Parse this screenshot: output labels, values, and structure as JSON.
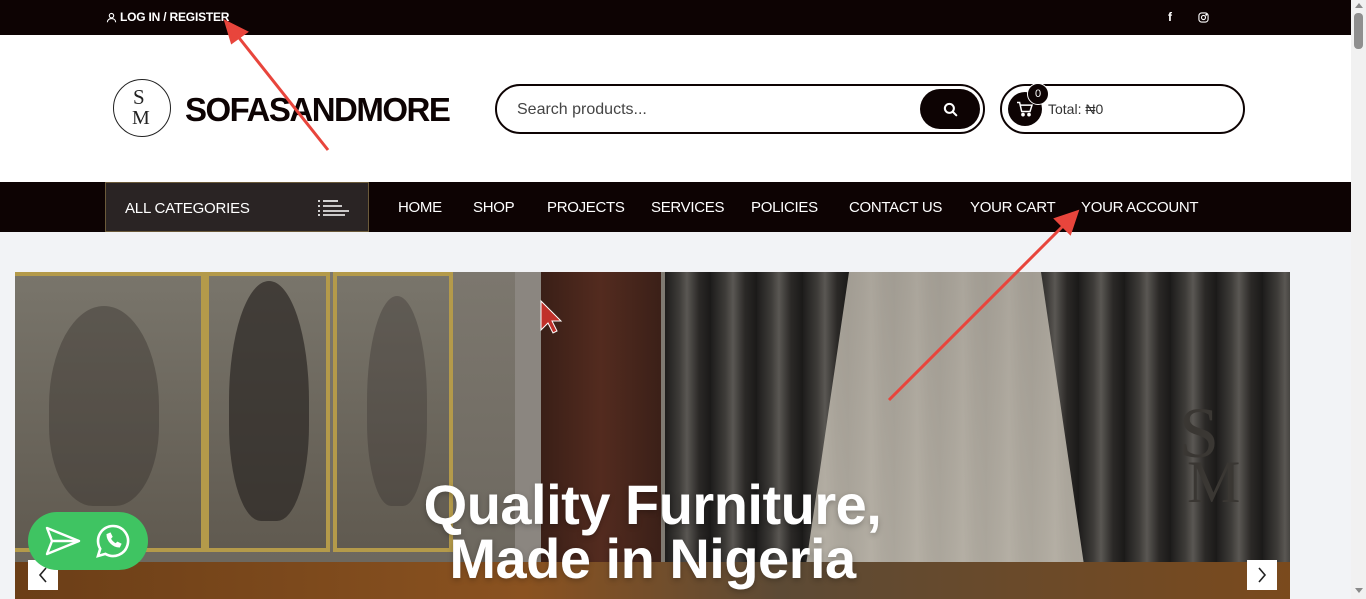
{
  "topbar": {
    "login_label": "LOG IN / REGISTER",
    "social": [
      {
        "icon": "facebook-icon",
        "glyph": "f"
      },
      {
        "icon": "instagram-icon"
      }
    ]
  },
  "header": {
    "logo_monogram_top": "S",
    "logo_monogram_bottom": "M",
    "brand_name": "SOFASANDMORE",
    "search": {
      "placeholder": "Search products...",
      "icon": "search-icon"
    },
    "cart": {
      "count": "0",
      "total_label": "Total: ₦0",
      "icon": "cart-icon"
    }
  },
  "nav": {
    "all_categories": "ALL CATEGORIES",
    "items": [
      "HOME",
      "SHOP",
      "PROJECTS",
      "SERVICES",
      "POLICIES",
      "CONTACT US",
      "YOUR CART",
      "YOUR ACCOUNT"
    ]
  },
  "hero": {
    "title_line1": "Quality Furniture,",
    "title_line2": "Made in Nigeria",
    "watermark_top": "S",
    "watermark_bottom": "M"
  },
  "chat": {
    "send_icon": "send-icon",
    "whatsapp_icon": "whatsapp-icon"
  },
  "colors": {
    "primary": "#0d0303",
    "whatsapp": "#3fc462",
    "annotation": "#e8453c"
  }
}
